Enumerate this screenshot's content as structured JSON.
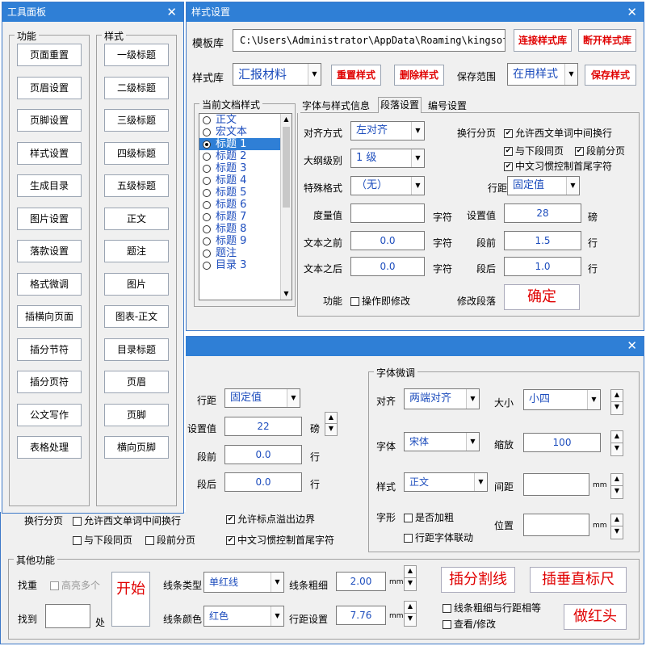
{
  "toolbox": {
    "title": "工具面板",
    "close": "✕",
    "func_label": "功能",
    "style_label": "样式",
    "func_buttons": [
      "页面重置",
      "页眉设置",
      "页脚设置",
      "样式设置",
      "生成目录",
      "图片设置",
      "落款设置",
      "格式微调",
      "插横向页面",
      "插分节符",
      "插分页符",
      "公文写作",
      "表格处理"
    ],
    "style_buttons": [
      "一级标题",
      "二级标题",
      "三级标题",
      "四级标题",
      "五级标题",
      "正文",
      "题注",
      "图片",
      "图表-正文",
      "目录标题",
      "页眉",
      "页脚",
      "横向页脚"
    ]
  },
  "style": {
    "title": "样式设置",
    "close": "✕",
    "template_label": "模板库",
    "template_path": "C:\\Users\\Administrator\\AppData\\Roaming\\kingsoft",
    "connect_btn": "连接样式库",
    "disconnect_btn": "断开样式库",
    "lib_label": "样式库",
    "lib_value": "汇报材料",
    "reset_btn": "重置样式",
    "delete_btn": "删除样式",
    "scope_label": "保存范围",
    "scope_value": "在用样式",
    "save_btn": "保存样式",
    "current_label": "当前文档样式",
    "styles": [
      "正文",
      "宏文本",
      "标题 1",
      "标题 2",
      "标题 3",
      "标题 4",
      "标题 5",
      "标题 6",
      "标题 7",
      "标题 8",
      "标题 9",
      "题注",
      "目录 3"
    ],
    "selected_style": "标题 1",
    "tabs": [
      "字体与样式信息",
      "段落设置",
      "编号设置"
    ],
    "align_label": "对齐方式",
    "align_value": "左对齐",
    "outline_label": "大纲级别",
    "outline_value": "1 级",
    "special_label": "特殊格式",
    "special_value": "（无）",
    "measure_label": "度量值",
    "measure_value": "",
    "unit_char": "字符",
    "before_text_label": "文本之前",
    "before_text_value": "0.0",
    "after_text_label": "文本之后",
    "after_text_value": "0.0",
    "pagebreak_label": "换行分页",
    "chk_allow_break": "允许西文单词中间换行",
    "chk_keep_next": "与下段同页",
    "chk_break_before": "段前分页",
    "chk_cjk": "中文习惯控制首尾字符",
    "spacing_label": "行距",
    "spacing_value": "固定值",
    "setval_label": "设置值",
    "setval_value": "28",
    "unit_pound": "磅",
    "before_label": "段前",
    "before_value": "1.5",
    "unit_line": "行",
    "after_label": "段后",
    "after_value": "1.0",
    "func_label": "功能",
    "instant_label": "操作即修改",
    "modify_label": "修改段落",
    "confirm_btn": "确定"
  },
  "bottom": {
    "close": "✕",
    "spacing_label": "行距",
    "spacing_value": "固定值",
    "setval_label": "设置值",
    "setval_value": "22",
    "unit_pound": "磅",
    "before_label": "段前",
    "before_value": "0.0",
    "unit_line": "行",
    "after_label": "段后",
    "after_value": "0.0",
    "pagebreak_label": "换行分页",
    "chk_allow_break": "允许西文单词中间换行",
    "chk_keep_next": "与下段同页",
    "chk_break_before": "段前分页",
    "chk_overflow": "允许标点溢出边界",
    "chk_cjk": "中文习惯控制首尾字符",
    "font_label": "字体微调",
    "align_label": "对齐",
    "align_value": "两端对齐",
    "size_label": "大小",
    "size_value": "小四",
    "font_name_label": "字体",
    "font_name_value": "宋体",
    "scale_label": "缩放",
    "scale_value": "100",
    "style_label": "样式",
    "style_value": "正文",
    "gap_label": "间距",
    "unit_mm": "mm",
    "shape_label": "字形",
    "chk_bold": "是否加粗",
    "chk_link": "行距字体联动",
    "pos_label": "位置",
    "other_label": "其他功能",
    "dup_label": "找重",
    "highlight_label": "高亮多个",
    "find_label": "找到",
    "find_unit": "处",
    "start_btn": "开始",
    "line_type_label": "线条类型",
    "line_type_value": "单红线",
    "line_thick_label": "线条粗细",
    "line_thick_value": "2.00",
    "line_color_label": "线条颜色",
    "line_color_value": "红色",
    "line_space_label": "行距设置",
    "line_space_value": "7.76",
    "split_btn": "插分割线",
    "ruler_btn": "插垂直标尺",
    "chk_equal": "线条粗细与行距相等",
    "chk_view": "查看/修改",
    "redhead_btn": "做红头"
  }
}
